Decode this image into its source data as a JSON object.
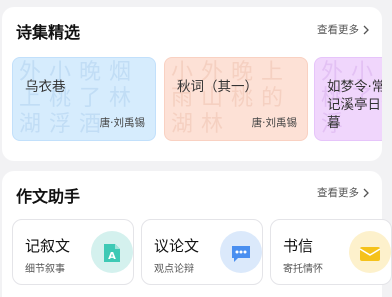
{
  "poems_section": {
    "title": "诗集精选",
    "more_label": "查看更多",
    "items": [
      {
        "title": "乌衣巷",
        "author": "唐·刘禹锡",
        "bg": "外小晚烟上桃了林湖浮酒"
      },
      {
        "title": "秋词（其一）",
        "author": "唐·刘禹锡",
        "bg": "小外晚上雨山桃的湖林"
      },
      {
        "title": "如梦令·常记溪亭日暮",
        "author": "",
        "bg": "外小晚烟桃了林湖浮"
      }
    ]
  },
  "essay_section": {
    "title": "作文助手",
    "more_label": "查看更多",
    "tools": [
      {
        "name": "记叙文",
        "desc": "细节叙事",
        "icon": "document-a-icon",
        "color": "#3ec9b5"
      },
      {
        "name": "议论文",
        "desc": "观点论辩",
        "icon": "chat-bubble-icon",
        "color": "#4a8ff0"
      },
      {
        "name": "书信",
        "desc": "寄托情怀",
        "icon": "envelope-icon",
        "color": "#f5c21b"
      }
    ]
  }
}
